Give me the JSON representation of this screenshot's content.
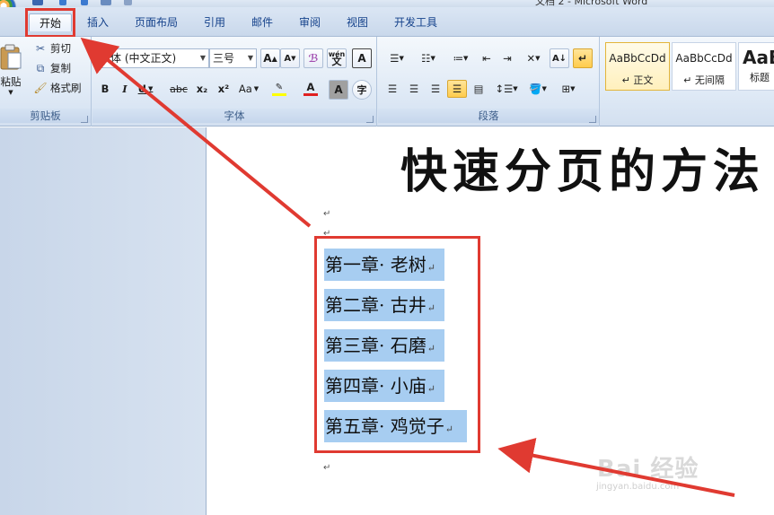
{
  "window": {
    "title": "文档 2 - Microsoft Word"
  },
  "tabs": [
    {
      "label": "开始",
      "active": true
    },
    {
      "label": "插入"
    },
    {
      "label": "页面布局"
    },
    {
      "label": "引用"
    },
    {
      "label": "邮件"
    },
    {
      "label": "审阅"
    },
    {
      "label": "视图"
    },
    {
      "label": "开发工具"
    }
  ],
  "clipboard": {
    "paste_label": "粘贴",
    "cut_label": "剪切",
    "copy_label": "复制",
    "format_painter_label": "格式刷",
    "group_label": "剪贴板"
  },
  "font": {
    "font_name": "宋体 (中文正文)",
    "font_size": "三号",
    "group_label": "字体",
    "bold": "B",
    "italic": "I",
    "underline": "U",
    "strike": "abc",
    "subscript": "x₂",
    "superscript": "x²",
    "change_case": "Aa",
    "grow": "A",
    "shrink": "A",
    "phonetic": "wén",
    "border_char": "A",
    "char_shading": "A",
    "enclose": "字",
    "font_color": "A",
    "highlight": "aby"
  },
  "paragraph": {
    "group_label": "段落"
  },
  "styles": {
    "items": [
      {
        "sample": "AaBbCcDd",
        "name": "↵ 正文"
      },
      {
        "sample": "AaBbCcDd",
        "name": "↵ 无间隔"
      },
      {
        "sample": "AaB",
        "name": "标题"
      }
    ]
  },
  "document": {
    "title": "快速分页的方法",
    "chapters": [
      "第一章· 老树",
      "第二章· 古井",
      "第三章· 石磨",
      "第四章· 小庙",
      "第五章· 鸡觉子"
    ],
    "paragraph_mark": "↵"
  },
  "watermark": {
    "text": "Bai 经验",
    "url": "jingyan.baidu.com"
  },
  "colors": {
    "selection": "#a7cdf1",
    "annotation": "#e03a31",
    "ribbon": "#dde8f5"
  }
}
